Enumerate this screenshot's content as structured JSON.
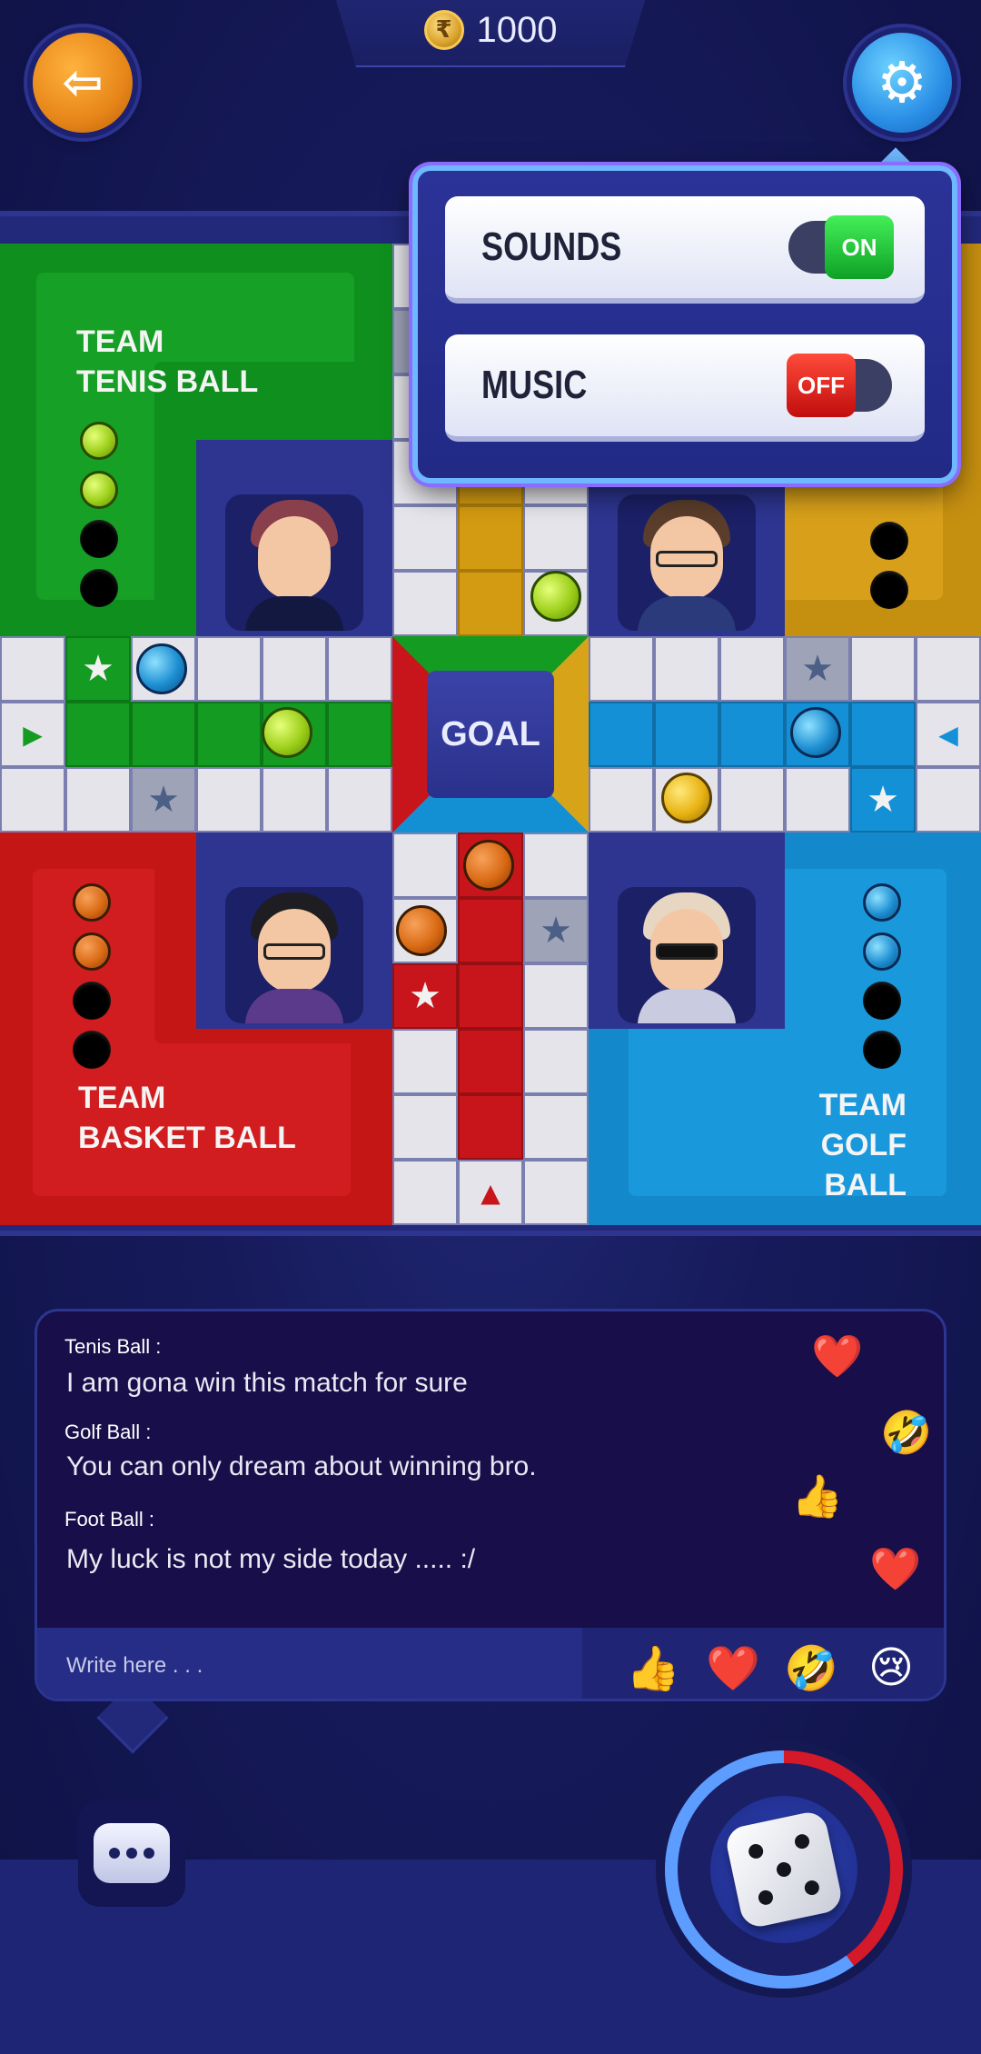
{
  "header": {
    "coin_symbol": "₹",
    "coin_balance": "1000",
    "back_icon": "exit-arrow-icon",
    "settings_icon": "gear-icon"
  },
  "teams": {
    "green": {
      "label": "TEAM\nTENIS BALL",
      "color": "#139b22",
      "tokens_home": 2
    },
    "yellow": {
      "label": "",
      "color": "#d39b12",
      "tokens_home": 2
    },
    "red": {
      "label": "TEAM\nBASKET BALL",
      "color": "#c8151b",
      "tokens_home": 2
    },
    "blue": {
      "label": "TEAM\nGOLF BALL",
      "color": "#1490d6",
      "tokens_home": 2
    }
  },
  "board": {
    "goal_label": "GOAL"
  },
  "settings": {
    "sounds": {
      "label": "SOUNDS",
      "state": "ON"
    },
    "music": {
      "label": "MUSIC",
      "state": "OFF"
    }
  },
  "chat": {
    "messages": [
      {
        "name": "Tenis Ball :",
        "text": "I am gona win this match for sure",
        "name_color": "#2ecc40"
      },
      {
        "name": "Golf Ball :",
        "text": "You can only dream about winning bro.",
        "name_color": "#2aa6e8"
      },
      {
        "name": "Foot Ball :",
        "text": "My luck is not my side today ..... :/",
        "name_color": "#e6a419"
      }
    ],
    "floating_reactions": [
      "❤️",
      "🤣",
      "👍",
      "❤️"
    ],
    "input_placeholder": "Write here . . .",
    "quick_reactions": [
      "👍",
      "❤️",
      "🤣",
      "😢"
    ]
  },
  "controls": {
    "chat_button_icon": "chat-bubble-icon",
    "dice_icon": "dice-icon",
    "dice_face": 5
  }
}
